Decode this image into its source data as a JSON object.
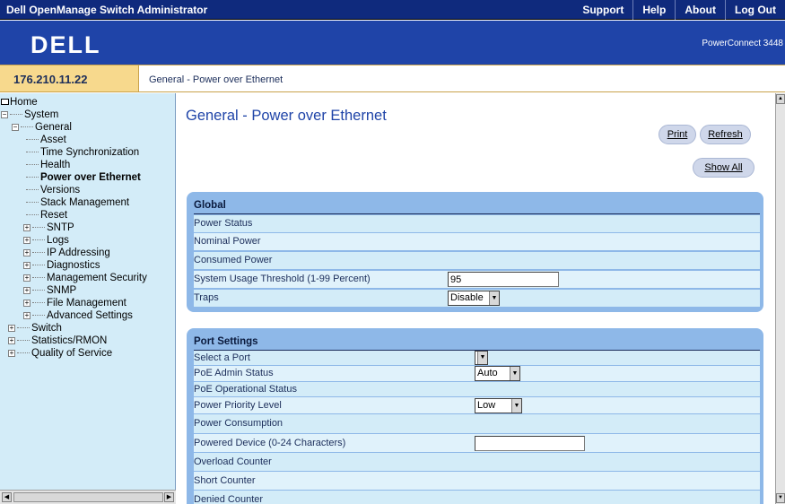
{
  "header": {
    "app_title": "Dell OpenManage Switch Administrator",
    "nav": [
      "Support",
      "Help",
      "About",
      "Log Out"
    ],
    "logo": "DELL",
    "model": "PowerConnect 3448"
  },
  "address": {
    "ip": "176.210.11.22",
    "breadcrumb": "General - Power over Ethernet"
  },
  "sidebar": {
    "items": [
      {
        "label": "Home",
        "level": 0
      },
      {
        "label": "System",
        "level": 1,
        "expander": "-"
      },
      {
        "label": "General",
        "level": 2,
        "expander": "-"
      },
      {
        "label": "Asset",
        "level": 3
      },
      {
        "label": "Time Synchronization",
        "level": 3
      },
      {
        "label": "Health",
        "level": 3
      },
      {
        "label": "Power over Ethernet",
        "level": 3,
        "selected": true
      },
      {
        "label": "Versions",
        "level": 3
      },
      {
        "label": "Stack Management",
        "level": 3
      },
      {
        "label": "Reset",
        "level": 3
      },
      {
        "label": "SNTP",
        "level": 2,
        "expander": "+"
      },
      {
        "label": "Logs",
        "level": 2,
        "expander": "+"
      },
      {
        "label": "IP Addressing",
        "level": 2,
        "expander": "+"
      },
      {
        "label": "Diagnostics",
        "level": 2,
        "expander": "+"
      },
      {
        "label": "Management Security",
        "level": 2,
        "expander": "+"
      },
      {
        "label": "SNMP",
        "level": 2,
        "expander": "+"
      },
      {
        "label": "File Management",
        "level": 2,
        "expander": "+"
      },
      {
        "label": "Advanced Settings",
        "level": 2,
        "expander": "+"
      },
      {
        "label": "Switch",
        "level": 1,
        "expander": "+"
      },
      {
        "label": "Statistics/RMON",
        "level": 1,
        "expander": "+"
      },
      {
        "label": "Quality of Service",
        "level": 1,
        "expander": "+"
      }
    ]
  },
  "main": {
    "title": "General - Power over Ethernet",
    "buttons": {
      "print": "Print",
      "refresh": "Refresh",
      "show_all": "Show All"
    },
    "global": {
      "heading": "Global",
      "rows": [
        "Power Status",
        "Nominal Power",
        "Consumed Power",
        "System Usage Threshold (1-99 Percent)",
        "Traps"
      ],
      "threshold_value": "95",
      "traps_value": "Disable"
    },
    "port": {
      "heading": "Port Settings",
      "rows": [
        "Select a Port",
        "PoE Admin Status",
        "PoE Operational Status",
        "Power Priority Level",
        "Power Consumption",
        "Powered Device (0-24 Characters)",
        "Overload Counter",
        "Short Counter",
        "Denied Counter"
      ],
      "port_value": "",
      "admin_value": "Auto",
      "priority_value": "Low",
      "powered_device_value": ""
    }
  },
  "colors": {
    "top_bar": "#0f2a7d",
    "banner": "#1f44a8",
    "ip_cell": "#f7d98d",
    "sidebar": "#d3ecf8",
    "panel": "#8eb8e8",
    "title": "#1f44a8"
  },
  "icons": {
    "home": "home-icon",
    "expand": "plus-box-icon",
    "collapse": "minus-box-icon",
    "dropdown": "triangle-down-icon"
  }
}
